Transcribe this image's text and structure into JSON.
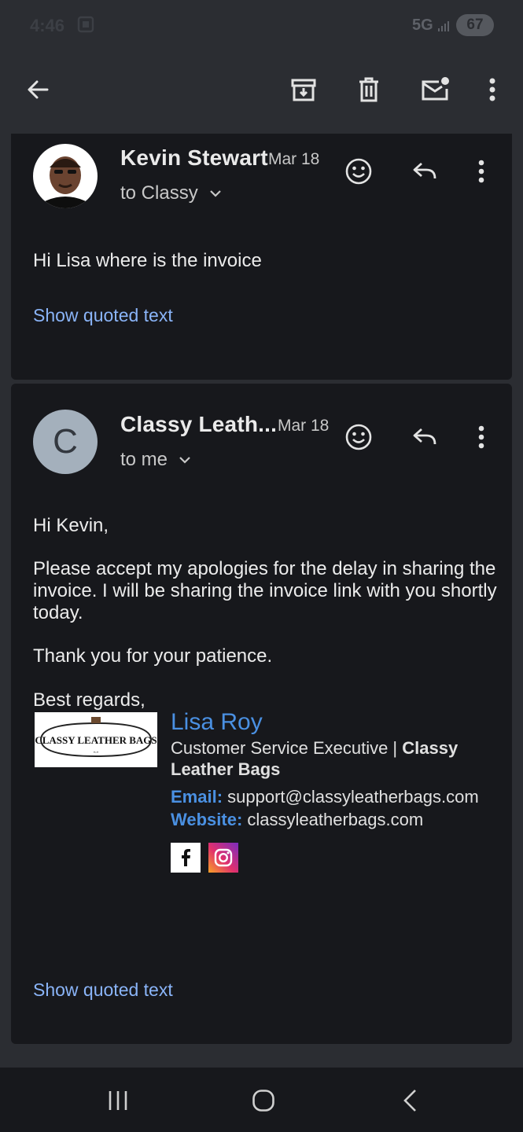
{
  "status_bar": {
    "time": "4:46",
    "network": "5G",
    "battery": "67"
  },
  "toolbar": {
    "icons": [
      "back-arrow-icon",
      "archive-icon",
      "trash-icon",
      "mark-unread-icon",
      "more-vert-icon"
    ]
  },
  "messages": [
    {
      "sender": "Kevin Stewart",
      "date": "Mar 18",
      "recipient": "to Classy",
      "body": "Hi Lisa where is the invoice",
      "show_quoted": "Show quoted text"
    },
    {
      "sender": "Classy Leath...",
      "avatar_letter": "C",
      "date": "Mar 18",
      "recipient": "to me",
      "greeting": "Hi Kevin,",
      "paragraph1": "Please accept my apologies for the delay in sharing the invoice. I will be sharing the invoice link with you shortly today.",
      "paragraph2": "Thank you for your patience.",
      "closing": "Best regards,",
      "signature": {
        "name": "Lisa Roy",
        "title_prefix": "Customer Service Executive | ",
        "title_company": "Classy Leather Bags",
        "email_label": "Email:",
        "email": "support@classyleatherbags.com",
        "website_label": "Website:",
        "website": "classyleatherbags.com",
        "logo_text": "CLASSY LEATHER BAGS"
      },
      "show_quoted": "Show quoted text"
    }
  ],
  "colors": {
    "background": "#2b2d32",
    "card": "#17181c",
    "link": "#8ab4f8",
    "signature_accent": "#4a90e2"
  }
}
